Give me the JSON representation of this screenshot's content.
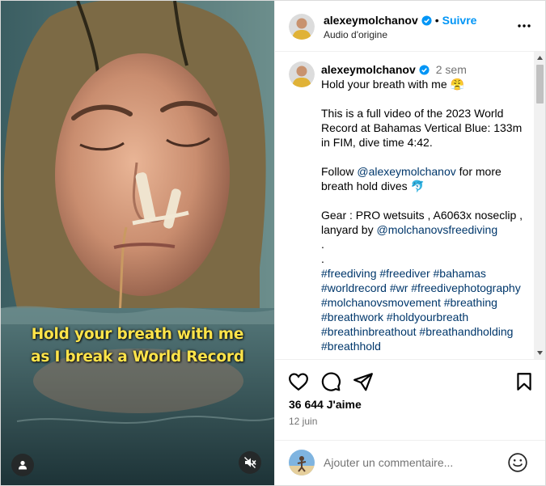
{
  "video": {
    "caption_line1": "Hold your breath with me",
    "caption_line2": "as I break a World Record"
  },
  "header": {
    "username": "alexeymolchanov",
    "separator": "•",
    "follow_label": "Suivre",
    "subtitle": "Audio d'origine"
  },
  "caption": {
    "username": "alexeymolchanov",
    "time": "2 sem",
    "lines": {
      "l1": "Hold your breath with me 😤",
      "l2": "This is a full video of the 2023 World Record at Bahamas Vertical Blue: 133m in FIM, dive time 4:42.",
      "l3a": "Follow ",
      "l3b": "@alexeymolchanov",
      "l3c": " for more breath hold dives 🐬",
      "l4a": "Gear : PRO wetsuits , A6063x noseclip , lanyard by ",
      "l4b": "@molchanovsfreediving",
      "dot1": ".",
      "dot2": ".",
      "tags": "#freediving #freediver #bahamas #worldrecord #wr #freedivephotography #molchanovsmovement #breathing #breathwork #holdyourbreath #breathinbreathout #breathandholding #breathhold"
    }
  },
  "stats": {
    "likes": "36 644 J'aime",
    "date": "12 juin"
  },
  "add_comment": {
    "placeholder": "Ajouter un commentaire..."
  },
  "colors": {
    "accent": "#0095f6",
    "link": "#00376b",
    "muted": "#737373",
    "caption_yellow": "#ffe44a"
  },
  "icons": [
    "verified-badge-icon",
    "more-options-icon",
    "heart-icon",
    "comment-icon",
    "share-icon",
    "save-icon",
    "user-tag-icon",
    "mute-icon",
    "emoji-icon",
    "scroll-up-icon",
    "scroll-down-icon"
  ]
}
